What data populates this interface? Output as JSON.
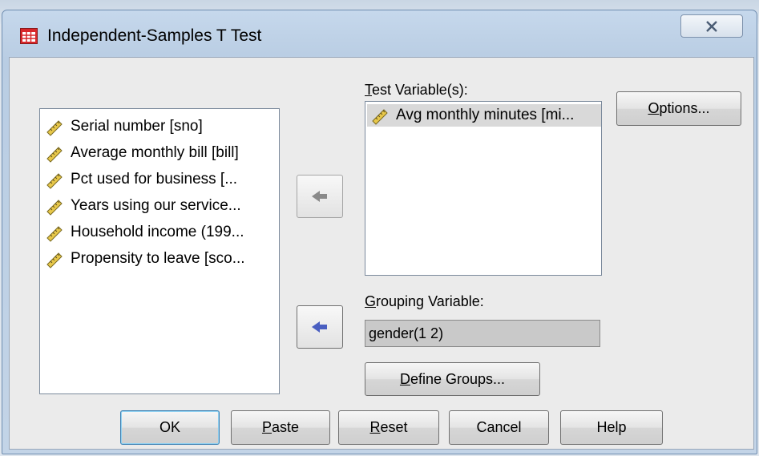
{
  "window": {
    "title": "Independent-Samples T Test",
    "icon": "spss-dialog-icon",
    "close_icon": "close-x-icon"
  },
  "source_list": {
    "items": [
      {
        "label": "Serial number [sno]",
        "icon": "scale-ruler-icon"
      },
      {
        "label": "Average monthly bill [bill]",
        "icon": "scale-ruler-icon"
      },
      {
        "label": "Pct used for business [...",
        "icon": "scale-ruler-icon"
      },
      {
        "label": "Years using our service...",
        "icon": "scale-ruler-icon"
      },
      {
        "label": "Household income (199...",
        "icon": "scale-ruler-icon"
      },
      {
        "label": "Propensity to leave [sco...",
        "icon": "scale-ruler-icon"
      }
    ]
  },
  "test_variables": {
    "label_prefix": "",
    "label_accel": "T",
    "label_rest": "est Variable(s):",
    "items": [
      {
        "label": "Avg monthly minutes [mi...",
        "icon": "scale-ruler-icon"
      }
    ]
  },
  "grouping": {
    "label_accel": "G",
    "label_rest": "rouping Variable:",
    "value": "gender(1 2)"
  },
  "buttons": {
    "options": {
      "accel": "O",
      "rest": "ptions..."
    },
    "define_groups": {
      "accel": "D",
      "rest": "efine Groups..."
    },
    "ok": "OK",
    "paste": {
      "accel": "P",
      "rest": "aste"
    },
    "reset": {
      "accel": "R",
      "rest": "eset"
    },
    "cancel": "Cancel",
    "help": "Help"
  },
  "colors": {
    "arrow_disabled": "#8a8a8a",
    "arrow_active": "#4a5fc1",
    "icon_red": "#d8262a",
    "ruler_yellow": "#e8c84a"
  }
}
